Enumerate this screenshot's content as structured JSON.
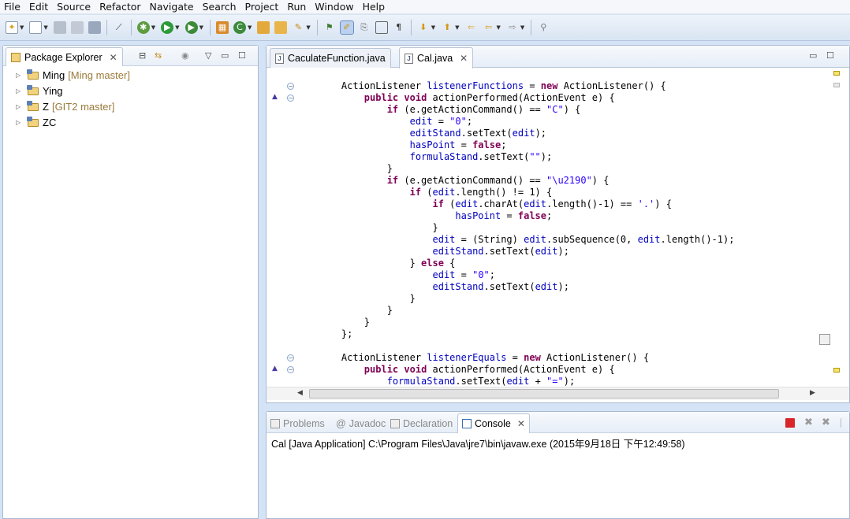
{
  "menu": [
    "File",
    "Edit",
    "Source",
    "Refactor",
    "Navigate",
    "Search",
    "Project",
    "Run",
    "Window",
    "Help"
  ],
  "toolbar": {
    "icons": [
      "new-icon",
      "new-wizard-icon",
      "save-icon",
      "save-all-icon",
      "print-icon",
      "skip-breakpoints-icon",
      "debug-icon",
      "run-icon",
      "run-external-tool-icon",
      "new-java-project-icon",
      "new-class-icon",
      "open-type-icon",
      "open-folder-icon",
      "search-icon",
      "next-annotation-icon",
      "mark-occurrences-icon",
      "toggle-block-selection-icon",
      "show-whitespace-icon",
      "pilcrow-icon",
      "next-edit-icon",
      "previous-edit-icon",
      "back-icon",
      "forward-icon",
      "pin-editor-icon"
    ]
  },
  "package_explorer": {
    "title": "Package Explorer",
    "projects": [
      {
        "name": "Ming",
        "git": "[Ming master]"
      },
      {
        "name": "Ying",
        "git": ""
      },
      {
        "name": "Z",
        "git": "[GIT2 master]"
      },
      {
        "name": "ZC",
        "git": ""
      }
    ]
  },
  "editor": {
    "tabs": [
      {
        "label": "CaculateFunction.java",
        "active": false
      },
      {
        "label": "Cal.java",
        "active": true
      }
    ],
    "code": [
      [
        {
          "t": "    ",
          "c": ""
        },
        {
          "t": "ActionListener ",
          "c": ""
        },
        {
          "t": "listenerFunctions",
          "c": "fld"
        },
        {
          "t": " = ",
          "c": ""
        },
        {
          "t": "new",
          "c": "kw"
        },
        {
          "t": " ActionListener() {",
          "c": ""
        }
      ],
      [
        {
          "t": "        ",
          "c": ""
        },
        {
          "t": "public",
          "c": "kw"
        },
        {
          "t": " ",
          "c": ""
        },
        {
          "t": "void",
          "c": "kw"
        },
        {
          "t": " actionPerformed(ActionEvent e) {",
          "c": ""
        }
      ],
      [
        {
          "t": "            ",
          "c": ""
        },
        {
          "t": "if",
          "c": "kw"
        },
        {
          "t": " (e.getActionCommand() == ",
          "c": ""
        },
        {
          "t": "\"C\"",
          "c": "str"
        },
        {
          "t": ") {",
          "c": ""
        }
      ],
      [
        {
          "t": "                ",
          "c": ""
        },
        {
          "t": "edit",
          "c": "fld"
        },
        {
          "t": " = ",
          "c": ""
        },
        {
          "t": "\"0\"",
          "c": "str"
        },
        {
          "t": ";",
          "c": ""
        }
      ],
      [
        {
          "t": "                ",
          "c": ""
        },
        {
          "t": "editStand",
          "c": "fld"
        },
        {
          "t": ".setText(",
          "c": ""
        },
        {
          "t": "edit",
          "c": "fld"
        },
        {
          "t": ");",
          "c": ""
        }
      ],
      [
        {
          "t": "                ",
          "c": ""
        },
        {
          "t": "hasPoint",
          "c": "fld"
        },
        {
          "t": " = ",
          "c": ""
        },
        {
          "t": "false",
          "c": "kw"
        },
        {
          "t": ";",
          "c": ""
        }
      ],
      [
        {
          "t": "                ",
          "c": ""
        },
        {
          "t": "formulaStand",
          "c": "fld"
        },
        {
          "t": ".setText(",
          "c": ""
        },
        {
          "t": "\"\"",
          "c": "str"
        },
        {
          "t": ");",
          "c": ""
        }
      ],
      [
        {
          "t": "            }",
          "c": ""
        }
      ],
      [
        {
          "t": "            ",
          "c": ""
        },
        {
          "t": "if",
          "c": "kw"
        },
        {
          "t": " (e.getActionCommand() == ",
          "c": ""
        },
        {
          "t": "\"\\u2190\"",
          "c": "str"
        },
        {
          "t": ") {",
          "c": ""
        }
      ],
      [
        {
          "t": "                ",
          "c": ""
        },
        {
          "t": "if",
          "c": "kw"
        },
        {
          "t": " (",
          "c": ""
        },
        {
          "t": "edit",
          "c": "fld"
        },
        {
          "t": ".length() != 1) {",
          "c": ""
        }
      ],
      [
        {
          "t": "                    ",
          "c": ""
        },
        {
          "t": "if",
          "c": "kw"
        },
        {
          "t": " (",
          "c": ""
        },
        {
          "t": "edit",
          "c": "fld"
        },
        {
          "t": ".charAt(",
          "c": ""
        },
        {
          "t": "edit",
          "c": "fld"
        },
        {
          "t": ".length()-1) == ",
          "c": ""
        },
        {
          "t": "'.'",
          "c": "str"
        },
        {
          "t": ") {",
          "c": ""
        }
      ],
      [
        {
          "t": "                        ",
          "c": ""
        },
        {
          "t": "hasPoint",
          "c": "fld"
        },
        {
          "t": " = ",
          "c": ""
        },
        {
          "t": "false",
          "c": "kw"
        },
        {
          "t": ";",
          "c": ""
        }
      ],
      [
        {
          "t": "                    }",
          "c": ""
        }
      ],
      [
        {
          "t": "                    ",
          "c": ""
        },
        {
          "t": "edit",
          "c": "fld"
        },
        {
          "t": " = (String) ",
          "c": ""
        },
        {
          "t": "edit",
          "c": "fld"
        },
        {
          "t": ".subSequence(0, ",
          "c": ""
        },
        {
          "t": "edit",
          "c": "fld"
        },
        {
          "t": ".length()-1);",
          "c": ""
        }
      ],
      [
        {
          "t": "                    ",
          "c": ""
        },
        {
          "t": "editStand",
          "c": "fld"
        },
        {
          "t": ".setText(",
          "c": ""
        },
        {
          "t": "edit",
          "c": "fld"
        },
        {
          "t": ");",
          "c": ""
        }
      ],
      [
        {
          "t": "                } ",
          "c": ""
        },
        {
          "t": "else",
          "c": "kw"
        },
        {
          "t": " {",
          "c": ""
        }
      ],
      [
        {
          "t": "                    ",
          "c": ""
        },
        {
          "t": "edit",
          "c": "fld"
        },
        {
          "t": " = ",
          "c": ""
        },
        {
          "t": "\"0\"",
          "c": "str"
        },
        {
          "t": ";",
          "c": ""
        }
      ],
      [
        {
          "t": "                    ",
          "c": ""
        },
        {
          "t": "editStand",
          "c": "fld"
        },
        {
          "t": ".setText(",
          "c": ""
        },
        {
          "t": "edit",
          "c": "fld"
        },
        {
          "t": ");",
          "c": ""
        }
      ],
      [
        {
          "t": "                }",
          "c": ""
        }
      ],
      [
        {
          "t": "            }",
          "c": ""
        }
      ],
      [
        {
          "t": "        }",
          "c": ""
        }
      ],
      [
        {
          "t": "    };",
          "c": ""
        }
      ],
      [
        {
          "t": "",
          "c": ""
        }
      ],
      [
        {
          "t": "    ",
          "c": ""
        },
        {
          "t": "ActionListener ",
          "c": ""
        },
        {
          "t": "listenerEquals",
          "c": "fld"
        },
        {
          "t": " = ",
          "c": ""
        },
        {
          "t": "new",
          "c": "kw"
        },
        {
          "t": " ActionListener() {",
          "c": ""
        }
      ],
      [
        {
          "t": "        ",
          "c": ""
        },
        {
          "t": "public",
          "c": "kw"
        },
        {
          "t": " ",
          "c": ""
        },
        {
          "t": "void",
          "c": "kw"
        },
        {
          "t": " actionPerformed(ActionEvent e) {",
          "c": ""
        }
      ],
      [
        {
          "t": "            ",
          "c": ""
        },
        {
          "t": "formulaStand",
          "c": "fld"
        },
        {
          "t": ".setText(",
          "c": ""
        },
        {
          "t": "edit",
          "c": "fld"
        },
        {
          "t": " + ",
          "c": ""
        },
        {
          "t": "\"=\"",
          "c": "str"
        },
        {
          "t": ");",
          "c": ""
        }
      ]
    ]
  },
  "bottom_panel": {
    "tabs": [
      {
        "label": "Problems",
        "active": false
      },
      {
        "label": "Javadoc",
        "active": false
      },
      {
        "label": "Declaration",
        "active": false
      },
      {
        "label": "Console",
        "active": true
      }
    ],
    "console_line": "Cal [Java Application] C:\\Program Files\\Java\\jre7\\bin\\javaw.exe (2015年9月18日 下午12:49:58)"
  },
  "colors": {
    "keyword": "#7f0055",
    "field": "#0000c0",
    "string": "#2a00ff",
    "terminate": "#d9242a"
  }
}
